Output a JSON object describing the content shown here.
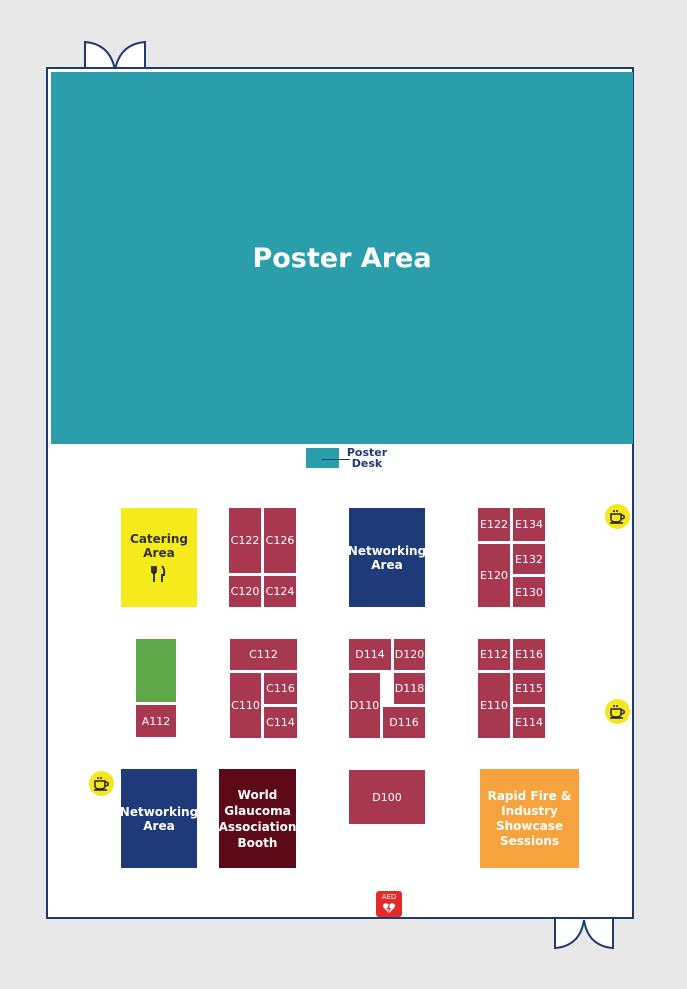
{
  "poster_area": {
    "label": "Poster Area"
  },
  "poster_desk": {
    "line1": "Poster",
    "line2": "Desk"
  },
  "catering": {
    "line1": "Catering",
    "line2": "Area",
    "icon": "fork-knife-icon"
  },
  "networking_top": {
    "line1": "Networking",
    "line2": "Area"
  },
  "networking_bottom": {
    "line1": "Networking",
    "line2": "Area"
  },
  "wga_booth": {
    "line1": "World",
    "line2": "Glaucoma",
    "line3": "Association",
    "line4": "Booth"
  },
  "rapid_fire": {
    "line1": "Rapid Fire &",
    "line2": "Industry",
    "line3": "Showcase",
    "line4": "Sessions"
  },
  "booths": {
    "a112": "A112",
    "c122": "C122",
    "c126": "C126",
    "c120": "C120",
    "c124": "C124",
    "c112": "C112",
    "c110": "C110",
    "c116": "C116",
    "c114": "C114",
    "d114": "D114",
    "d120": "D120",
    "d110": "D110",
    "d118": "D118",
    "d116": "D116",
    "d100": "D100",
    "e122": "E122",
    "e134": "E134",
    "e132": "E132",
    "e120": "E120",
    "e130": "E130",
    "e112": "E112",
    "e116": "E116",
    "e110": "E110",
    "e115": "E115",
    "e114": "E114"
  },
  "aed": {
    "label": "AED"
  },
  "colors": {
    "poster": "#2b9eab",
    "booth": "#a8384f",
    "navy": "#1e3a78",
    "catering": "#f4ea1c",
    "green": "#5fa84a",
    "maroon": "#5c0a17",
    "orange": "#f6a23d"
  },
  "icons": {
    "coffee": "coffee-cup-icon",
    "aed": "aed-heart-icon",
    "door": "door-icon"
  }
}
